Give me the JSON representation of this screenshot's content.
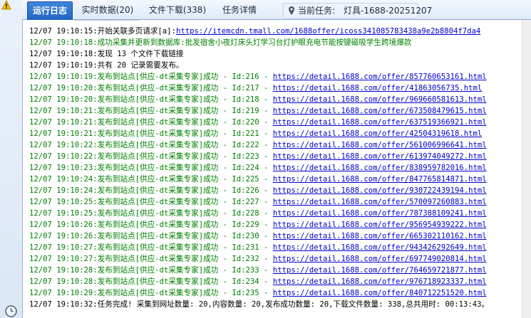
{
  "tabs": [
    {
      "label": "运行日志",
      "active": true
    },
    {
      "label": "实时数据(20)",
      "active": false
    },
    {
      "label": "文件下载(338)",
      "active": false
    },
    {
      "label": "任务详情",
      "active": false
    }
  ],
  "current_task": {
    "label": "当前任务:",
    "value": "灯具-1688-20251207"
  },
  "icons": {
    "warning": "warning-icon",
    "pin": "location-pin-icon",
    "clock": "clock-icon"
  },
  "colors": {
    "tab_active": "#2d72d2",
    "log_green": "#008000",
    "log_black": "#000000",
    "link": "#0000cc"
  },
  "log_lines": [
    {
      "text": "12/07 19:10:15:开始关联多页请求[a]:",
      "link": "https://itemcdn.tmall.com/1688offer/icoss341085783438a9e2b8804f7da4",
      "color": "black"
    },
    {
      "text": "12/07 19:10:18:成功采集并更新到数据库:批发宿舍小夜灯床头灯学习台灯护眼充电节能按键磁吸学生跨境爆款",
      "link": "",
      "color": "green"
    },
    {
      "text": "12/07 19:10:18:发现 13 个文件下载链接",
      "link": "",
      "color": "black"
    },
    {
      "text": "12/07 19:10:19:共有 20 记录需要发布。",
      "link": "",
      "color": "black"
    },
    {
      "text": "12/07 19:10:19:发布到站点[供应-dt采集专家]成功 - Id:216 - ",
      "link": "https://detail.1688.com/offer/857760653161.html",
      "color": "green"
    },
    {
      "text": "12/07 19:10:20:发布到站点[供应-dt采集专家]成功 - Id:217 - ",
      "link": "https://detail.1688.com/offer/41863056735.html",
      "color": "green"
    },
    {
      "text": "12/07 19:10:20:发布到站点[供应-dt采集专家]成功 - Id:218 - ",
      "link": "https://detail.1688.com/offer/969660581613.html",
      "color": "green"
    },
    {
      "text": "12/07 19:10:21:发布到站点[供应-dt采集专家]成功 - Id:219 - ",
      "link": "https://detail.1688.com/offer/673508479615.html",
      "color": "green"
    },
    {
      "text": "12/07 19:10:21:发布到站点[供应-dt采集专家]成功 - Id:220 - ",
      "link": "https://detail.1688.com/offer/637519366921.html",
      "color": "green"
    },
    {
      "text": "12/07 19:10:21:发布到站点[供应-dt采集专家]成功 - Id:221 - ",
      "link": "https://detail.1688.com/offer/42504319618.html",
      "color": "green"
    },
    {
      "text": "12/07 19:10:22:发布到站点[供应-dt采集专家]成功 - Id:222 - ",
      "link": "https://detail.1688.com/offer/561006996641.html",
      "color": "green"
    },
    {
      "text": "12/07 19:10:22:发布到站点[供应-dt采集专家]成功 - Id:223 - ",
      "link": "https://detail.1688.com/offer/613974049272.html",
      "color": "green"
    },
    {
      "text": "12/07 19:10:23:发布到站点[供应-dt采集专家]成功 - Id:224 - ",
      "link": "https://detail.1688.com/offer/838959782016.html",
      "color": "green"
    },
    {
      "text": "12/07 19:10:24:发布到站点[供应-dt采集专家]成功 - Id:225 - ",
      "link": "https://detail.1688.com/offer/847765814871.html",
      "color": "green"
    },
    {
      "text": "12/07 19:10:24:发布到站点[供应-dt采集专家]成功 - Id:226 - ",
      "link": "https://detail.1688.com/offer/930722439194.html",
      "color": "green"
    },
    {
      "text": "12/07 19:10:25:发布到站点[供应-dt采集专家]成功 - Id:227 - ",
      "link": "https://detail.1688.com/offer/570097260883.html",
      "color": "green"
    },
    {
      "text": "12/07 19:10:25:发布到站点[供应-dt采集专家]成功 - Id:228 - ",
      "link": "https://detail.1688.com/offer/787388109241.html",
      "color": "green"
    },
    {
      "text": "12/07 19:10:26:发布到站点[供应-dt采集专家]成功 - Id:229 - ",
      "link": "https://detail.1688.com/offer/956954939222.html",
      "color": "green"
    },
    {
      "text": "12/07 19:10:26:发布到站点[供应-dt采集专家]成功 - Id:230 - ",
      "link": "https://detail.1688.com/offer/665302110162.html",
      "color": "green"
    },
    {
      "text": "12/07 19:10:27:发布到站点[供应-dt采集专家]成功 - Id:231 - ",
      "link": "https://detail.1688.com/offer/943426292649.html",
      "color": "green"
    },
    {
      "text": "12/07 19:10:27:发布到站点[供应-dt采集专家]成功 - Id:232 - ",
      "link": "https://detail.1688.com/offer/697749020814.html",
      "color": "green"
    },
    {
      "text": "12/07 19:10:28:发布到站点[供应-dt采集专家]成功 - Id:233 - ",
      "link": "https://detail.1688.com/offer/764659721877.html",
      "color": "green"
    },
    {
      "text": "12/07 19:10:28:发布到站点[供应-dt采集专家]成功 - Id:234 - ",
      "link": "https://detail.1688.com/offer/976718923337.html",
      "color": "green"
    },
    {
      "text": "12/07 19:10:29:发布到站点[供应-dt采集专家]成功 - Id:235 - ",
      "link": "https://detail.1688.com/offer/840712251520.html",
      "color": "green"
    },
    {
      "text": "12/07 19:10:32:任务完成! 采集到网址数量: 20,内容数量: 20,发布成功数量: 20,下载文件数量: 338,总共用时: 00:13:43。",
      "link": "",
      "color": "black"
    }
  ]
}
